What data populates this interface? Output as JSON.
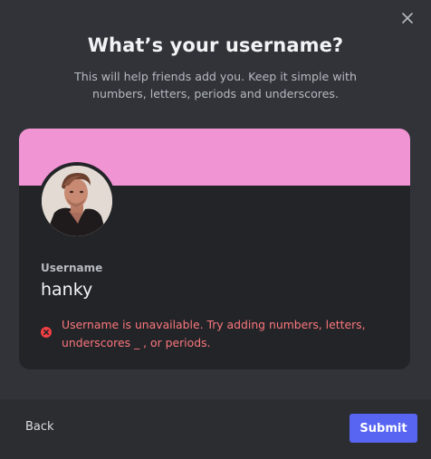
{
  "modal": {
    "title": "What’s your username?",
    "subtitle": "This will help friends add you. Keep it simple with numbers, letters, periods and underscores.",
    "close_icon": "close-icon"
  },
  "profile_card": {
    "banner_color": "#f194d4",
    "avatar_icon": "user-avatar-photo",
    "username_label": "Username",
    "username_value": "hanky",
    "error_icon": "error-circle-x-icon",
    "error_message": "Username is unavailable. Try adding numbers, letters, underscores _ , or periods."
  },
  "footer": {
    "back_label": "Back",
    "submit_label": "Submit",
    "accent_color": "#5865f2"
  },
  "colors": {
    "background": "#313338",
    "card": "#232428",
    "footer": "#2b2d31",
    "error": "#fa777c"
  }
}
